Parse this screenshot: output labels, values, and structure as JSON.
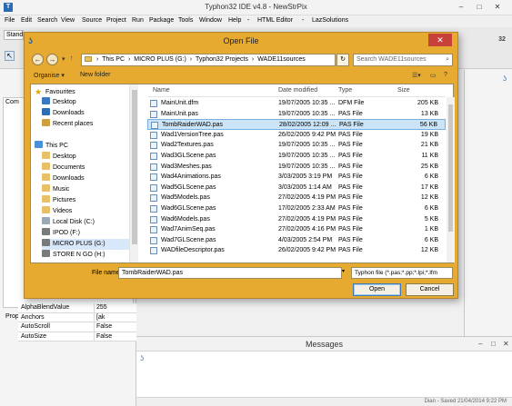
{
  "ide": {
    "title": "Typhon32 IDE v4.8 - NewStrPix",
    "menu": [
      "File",
      "Edit",
      "Search",
      "View",
      "Source",
      "Project",
      "Run",
      "Package",
      "Tools",
      "Window",
      "Help",
      "-",
      "HTML Editor",
      "-",
      "LazSolutions"
    ],
    "stand_tab": "Stand",
    "left_tab_com": "Com",
    "left_tab_prop": "Prop",
    "badge": "32",
    "properties": [
      {
        "name": "AlphaBlendValue",
        "value": "255"
      },
      {
        "name": "Anchors",
        "value": "[ak"
      },
      {
        "name": "AutoScroll",
        "value": "False"
      },
      {
        "name": "AutoSize",
        "value": "False"
      }
    ],
    "messages_title": "Messages",
    "status_text": "Dian - Saved 21/04/2014 9:22 PM"
  },
  "dialog": {
    "title": "Open File",
    "close_glyph": "✕",
    "breadcrumb": [
      "This PC",
      "MICRO PLUS (G:)",
      "Typhon32 Projects",
      "WADE11sources"
    ],
    "search_placeholder": "Search WADE11sources",
    "organise": "Organise ▾",
    "new_folder": "New folder",
    "nav": {
      "favourites": "Favourites",
      "fav_items": [
        "Desktop",
        "Downloads",
        "Recent places"
      ],
      "this_pc": "This PC",
      "pc_items": [
        "Desktop",
        "Documents",
        "Downloads",
        "Music",
        "Pictures",
        "Videos",
        "Local Disk (C:)",
        "IPOD (F:)",
        "MICRO PLUS (G:)",
        "STORE N GO (H:)"
      ]
    },
    "columns": {
      "name": "Name",
      "date": "Date modified",
      "type": "Type",
      "size": "Size"
    },
    "files": [
      {
        "name": "MainUnit.dfm",
        "date": "19/07/2005 10:35 ...",
        "type": "DFM File",
        "size": "205 KB"
      },
      {
        "name": "MainUnit.pas",
        "date": "19/07/2005 10:35 ...",
        "type": "PAS File",
        "size": "13 KB"
      },
      {
        "name": "TombRaiderWAD.pas",
        "date": "28/02/2005 12:09 ...",
        "type": "PAS File",
        "size": "56 KB"
      },
      {
        "name": "Wad1VersionTree.pas",
        "date": "26/02/2005 9:42 PM",
        "type": "PAS File",
        "size": "19 KB"
      },
      {
        "name": "Wad2Textures.pas",
        "date": "19/07/2005 10:35 ...",
        "type": "PAS File",
        "size": "21 KB"
      },
      {
        "name": "Wad3GLScene.pas",
        "date": "19/07/2005 10:35 ...",
        "type": "PAS File",
        "size": "11 KB"
      },
      {
        "name": "Wad3Meshes.pas",
        "date": "19/07/2005 10:35 ...",
        "type": "PAS File",
        "size": "25 KB"
      },
      {
        "name": "Wad4Animations.pas",
        "date": "3/03/2005 3:19 PM",
        "type": "PAS File",
        "size": "6 KB"
      },
      {
        "name": "Wad5GLScene.pas",
        "date": "3/03/2005 1:14 AM",
        "type": "PAS File",
        "size": "17 KB"
      },
      {
        "name": "Wad5Models.pas",
        "date": "27/02/2005 4:19 PM",
        "type": "PAS File",
        "size": "12 KB"
      },
      {
        "name": "Wad6GLScene.pas",
        "date": "17/02/2005 2:33 AM",
        "type": "PAS File",
        "size": "6 KB"
      },
      {
        "name": "Wad6Models.pas",
        "date": "27/02/2005 4:19 PM",
        "type": "PAS File",
        "size": "5 KB"
      },
      {
        "name": "Wad7AnimSeq.pas",
        "date": "27/02/2005 4:16 PM",
        "type": "PAS File",
        "size": "1 KB"
      },
      {
        "name": "Wad7GLScene.pas",
        "date": "4/03/2005 2:54 PM",
        "type": "PAS File",
        "size": "6 KB"
      },
      {
        "name": "WADfileDescriptor.pas",
        "date": "26/02/2005 9:42 PM",
        "type": "PAS File",
        "size": "12 KB"
      }
    ],
    "selected_index": 2,
    "filename_label": "File name:",
    "filename_value": "TombRaiderWAD.pas",
    "filetype_value": "Typhon file (*.pas;*.pp;*.lpi;*.lfm",
    "open_button": "Open",
    "cancel_button": "Cancel"
  },
  "colors": {
    "dialog_frame": "#e6aa30",
    "close_button": "#c7403a",
    "selection": "#cce4f7"
  }
}
